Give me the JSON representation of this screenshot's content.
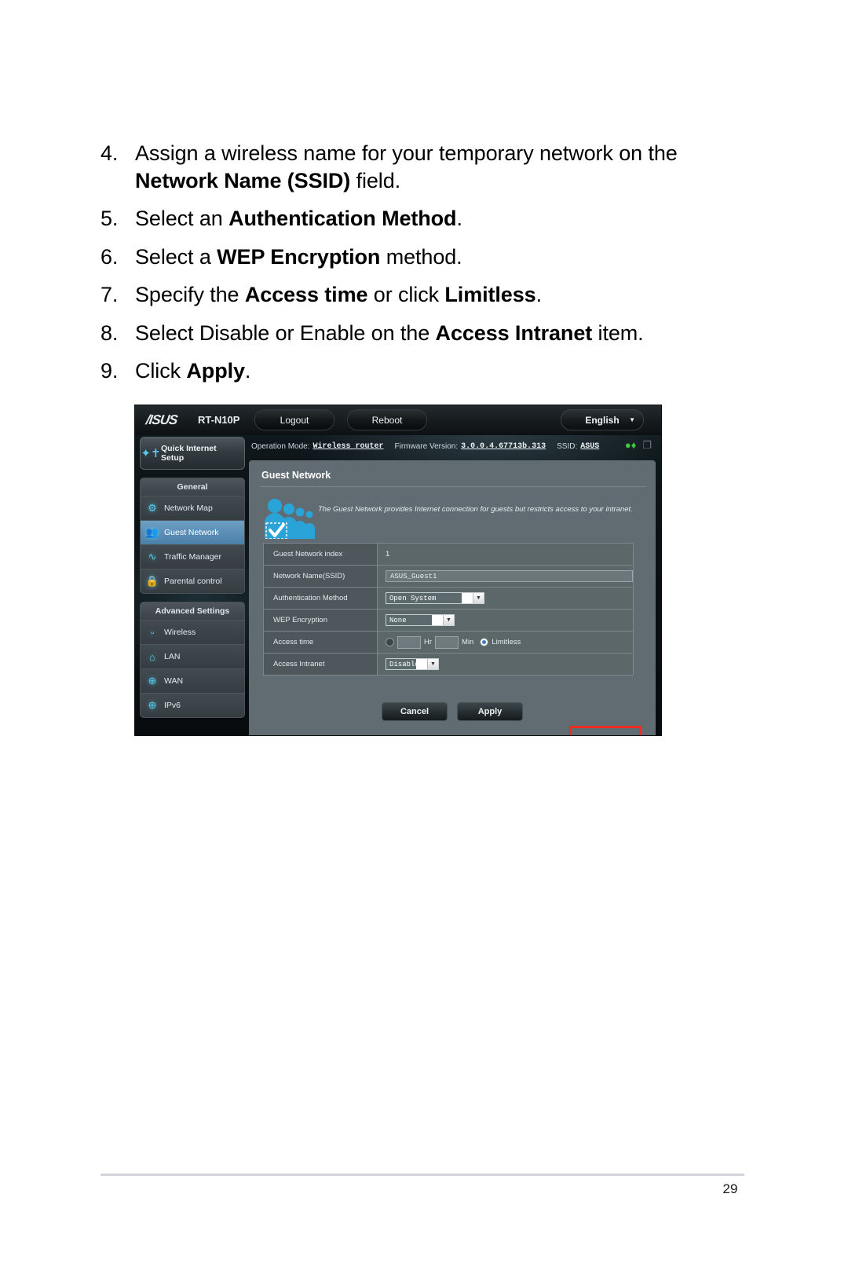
{
  "document": {
    "page_number": "29",
    "steps": [
      {
        "number": "4.",
        "parts": [
          {
            "text": "Assign a wireless name for your temporary network on the ",
            "bold": false
          },
          {
            "text": "Network Name (SSID)",
            "bold": true
          },
          {
            "text": " field.",
            "bold": false
          }
        ]
      },
      {
        "number": "5.",
        "parts": [
          {
            "text": "Select an ",
            "bold": false
          },
          {
            "text": "Authentication Method",
            "bold": true
          },
          {
            "text": ".",
            "bold": false
          }
        ]
      },
      {
        "number": "6.",
        "parts": [
          {
            "text": "Select a ",
            "bold": false
          },
          {
            "text": "WEP Encryption",
            "bold": true
          },
          {
            "text": " method.",
            "bold": false
          }
        ]
      },
      {
        "number": "7.",
        "parts": [
          {
            "text": "Specify the ",
            "bold": false
          },
          {
            "text": "Access time",
            "bold": true
          },
          {
            "text": " or click ",
            "bold": false
          },
          {
            "text": "Limitless",
            "bold": true
          },
          {
            "text": ".",
            "bold": false
          }
        ]
      },
      {
        "number": "8.",
        "parts": [
          {
            "text": "Select Disable or Enable on the ",
            "bold": false
          },
          {
            "text": "Access Intranet",
            "bold": true
          },
          {
            "text": " item.",
            "bold": false
          }
        ]
      },
      {
        "number": "9.",
        "parts": [
          {
            "text": "Click ",
            "bold": false
          },
          {
            "text": "Apply",
            "bold": true
          },
          {
            "text": ".",
            "bold": false
          }
        ]
      }
    ]
  },
  "router_ui": {
    "topbar": {
      "brand": "/ISUS",
      "model": "RT-N10P",
      "logout_label": "Logout",
      "reboot_label": "Reboot",
      "language_label": "English",
      "language_caret": "▼"
    },
    "infostrip": {
      "operation_mode_label": "Operation Mode:",
      "operation_mode_value": "Wireless router",
      "firmware_label": "Firmware Version:",
      "firmware_value": "3.0.0.4.67713b.313",
      "ssid_label": "SSID:",
      "ssid_value": "ASUS",
      "status_icons": [
        "user-status-icon",
        "copy-status-icon"
      ]
    },
    "sidebar": {
      "quick_setup_label": "Quick Internet\nSetup",
      "groups": [
        {
          "title": "General",
          "items": [
            {
              "label": "Network Map",
              "icon": "network-map-icon",
              "active": false
            },
            {
              "label": "Guest Network",
              "icon": "guest-network-icon",
              "active": true
            },
            {
              "label": "Traffic Manager",
              "icon": "traffic-manager-icon",
              "active": false
            },
            {
              "label": "Parental control",
              "icon": "parental-control-icon",
              "active": false
            }
          ]
        },
        {
          "title": "Advanced Settings",
          "items": [
            {
              "label": "Wireless",
              "icon": "wireless-icon",
              "active": false
            },
            {
              "label": "LAN",
              "icon": "lan-icon",
              "active": false
            },
            {
              "label": "WAN",
              "icon": "wan-icon",
              "active": false
            },
            {
              "label": "IPv6",
              "icon": "ipv6-icon",
              "active": false
            }
          ]
        }
      ]
    },
    "panel": {
      "title": "Guest Network",
      "description": "The Guest Network provides Internet connection for guests but restricts access to your intranet.",
      "fields": {
        "index_label": "Guest Network index",
        "index_value": "1",
        "ssid_label": "Network Name(SSID)",
        "ssid_value": "ASUS_Guest1",
        "auth_label": "Authentication Method",
        "auth_value": "Open System",
        "wep_label": "WEP Encryption",
        "wep_value": "None",
        "access_time_label": "Access time",
        "access_time_hr_value": "",
        "access_time_hr_unit": "Hr",
        "access_time_min_value": "",
        "access_time_min_unit": "Min",
        "limitless_label": "Limitless",
        "intranet_label": "Access Intranet",
        "intranet_value": "Disable"
      },
      "cancel_label": "Cancel",
      "apply_label": "Apply"
    },
    "annotation": {
      "highlight_color": "#EE2C22",
      "target": "apply-button-and-access-intranet"
    }
  }
}
